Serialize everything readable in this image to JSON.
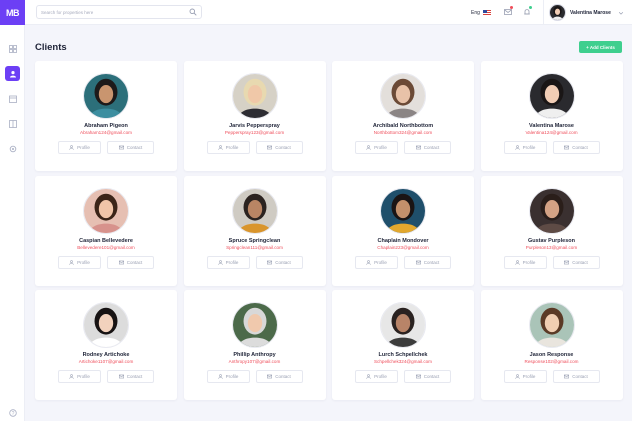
{
  "app": {
    "logo_text": "MB",
    "brand_color": "#6c3ff5",
    "accent_red": "#ef4d5a",
    "accent_green": "#3ecf8e"
  },
  "sidebar": {
    "items": [
      {
        "icon": "dashboard-icon",
        "active": false
      },
      {
        "icon": "user-icon",
        "active": true
      },
      {
        "icon": "calendar-icon",
        "active": false
      },
      {
        "icon": "book-icon",
        "active": false
      },
      {
        "icon": "settings-icon",
        "active": false
      }
    ],
    "help_icon": "help-icon"
  },
  "header": {
    "search_placeholder": "Search for properties here",
    "language": "Eng",
    "user_name": "Valentina Marose"
  },
  "page": {
    "title": "Clients",
    "add_button": "+ Add Clients"
  },
  "card_buttons": {
    "profile": "Profile",
    "contact": "Contact"
  },
  "clients": [
    {
      "name": "Abraham Pigeon",
      "email": "Abraham124@gmail.com",
      "bg": "#2c6f7a",
      "skin": "#c9956f",
      "hair": "#1d1a1a",
      "shirt": "#3d8ea0"
    },
    {
      "name": "Jarvis Pepperspray",
      "email": "Pepperspray123@gmail.com",
      "bg": "#d6d1c6",
      "skin": "#f0c8a8",
      "hair": "#e8d9b0",
      "shirt": "#2d2d33"
    },
    {
      "name": "Archibald Northbottom",
      "email": "Northbottom324@gmail.com",
      "bg": "#e3dfdb",
      "skin": "#e8c2a8",
      "hair": "#6b4a36",
      "shirt": "#8b8585"
    },
    {
      "name": "Valentina Marose",
      "email": "Valentina124@gmail.com",
      "bg": "#2a2a2e",
      "skin": "#f1cdb5",
      "hair": "#1a1616",
      "shirt": "#efefef"
    },
    {
      "name": "Caspian Bellevedere",
      "email": "Bellevedere101@gmail.com",
      "bg": "#e6bfb2",
      "skin": "#f0c4a8",
      "hair": "#3b2418",
      "shirt": "#d7928c"
    },
    {
      "name": "Spruce Springclean",
      "email": "Springclean111@gmail.com",
      "bg": "#cfcbc3",
      "skin": "#b98564",
      "hair": "#2b2320",
      "shirt": "#d9952c"
    },
    {
      "name": "Chaplain Mondover",
      "email": "Chaplain223@gmail.com",
      "bg": "#1f4f6b",
      "skin": "#c4906b",
      "hair": "#1a1414",
      "shirt": "#e2a82e"
    },
    {
      "name": "Gustav Purpleson",
      "email": "Purpleson13@gmail.com",
      "bg": "#3a3030",
      "skin": "#d4a284",
      "hair": "#2a1e1a",
      "shirt": "#5e4b45"
    },
    {
      "name": "Rodney Artichoke",
      "email": "Artichoke1107@gmail.com",
      "bg": "#dcdcdc",
      "skin": "#f2d2bd",
      "hair": "#171313",
      "shirt": "#ffffff"
    },
    {
      "name": "Phillip Anthropy",
      "email": "Anthropy107@gmail.com",
      "bg": "#4c6a4a",
      "skin": "#f0c9ad",
      "hair": "#d8d8d8",
      "shirt": "#dcdcdc"
    },
    {
      "name": "Lurch Schpellchek",
      "email": "Schpellchek324@gmail.com",
      "bg": "#e7e7e7",
      "skin": "#b88468",
      "hair": "#2a2220",
      "shirt": "#3c3c3c"
    },
    {
      "name": "Jason Response",
      "email": "Response102@gmail.com",
      "bg": "#aac4b8",
      "skin": "#f1ceb2",
      "hair": "#5b3a26",
      "shirt": "#e9e5de"
    }
  ]
}
